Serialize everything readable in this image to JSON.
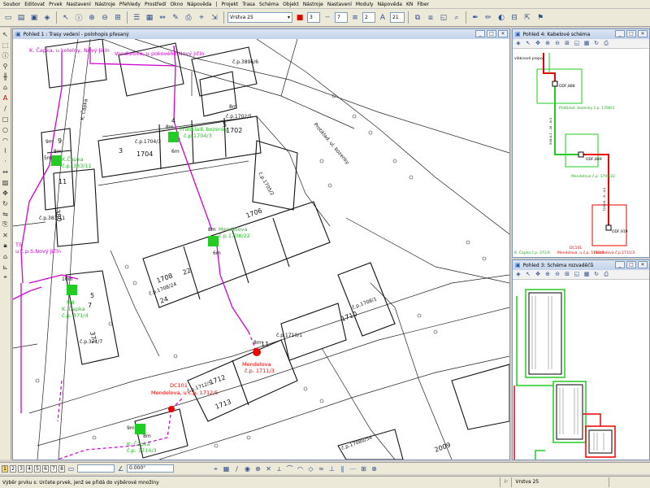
{
  "menu": [
    "Soubor",
    "Editovat",
    "Prvek",
    "Nastavení",
    "Nástroje",
    "Přehledy",
    "Prostředí",
    "Okno",
    "Nápověda",
    "|",
    "Projekt",
    "Trasa",
    "Schéma",
    "Objekt",
    "Nástroje",
    "Nastavení",
    "Moduly",
    "Nápověda",
    "KN",
    "Fiber"
  ],
  "toolbar": {
    "layer_combo": "Vrstva 25",
    "line_width": "3",
    "line_style": "7",
    "line_weight": "2",
    "zoom_value": "21"
  },
  "window_main": {
    "title": "Pohled 1 : Trasy vedení - polohopis přesaný",
    "labels_magenta": {
      "capka_kotelny": "K. Čapka, u kotelny, Nový Jičín",
      "vanduruva": "Vandurova, u pokovéhé Nový Jičín",
      "ts_nj": "TS",
      "ts_nj2": "u č.p.S.Nový Jičín",
      "dc101": "DC101",
      "dc101b": "Mendelova, u č.p. 1712/5"
    },
    "labels_green": {
      "ptkt_bozenky": "Protiklad. bozenky",
      "ptkt_bozenky2": "č.p.1704/3",
      "kcapka1": "K.Čapka",
      "kcapka1b": "č.p. 383/11",
      "mendelova1": "Mendelova",
      "mendelova1b": "č.p.1708/22",
      "m1": "M8",
      "m1b": "K. Čapka",
      "m1c": "č.p. 371/4",
      "kcapka2": "K. Čapka",
      "kcapka2b": "č.p. 1714/3"
    },
    "labels_red": {
      "mendelova_red": "Mendelova",
      "mendelova_red2": "č.p. 1711/3"
    },
    "map_texts": {
      "street1": "K. Čapka",
      "street2": "Protiklad. ul. bozenky",
      "street3": "Mendelova",
      "cp_17025": "č.p.1702/5",
      "cp_1702": "1702",
      "cp_17043": "č.p.1704/3",
      "cp_1704": "1704",
      "cp_17052": "č.p.1705/2",
      "cp_1706": "1706",
      "cp_1708": "1708",
      "cp_1708_24": "č.p.1708/24",
      "cp_22": "22",
      "cp_24": "24",
      "cp_3806": "č.p.3896/6",
      "cp_380": "380",
      "cp_3811": "č.p.383/11",
      "cp_371": "371",
      "cp_3717": "č.p.371/7",
      "cp_1710": "1710",
      "cp_17081": "č.p.1708/1",
      "cp_17101": "č.p.1710/1",
      "cp_11": "11",
      "cp_1712": "1712",
      "cp_17125": "č.p.1712/5",
      "cp_1713": "1713",
      "cp_2009": "2009",
      "cp_17135": "č.p.17080/54",
      "dist_8m_a": "8m",
      "dist_8m_b": "8m",
      "dist_6m_a": "6m",
      "dist_9m": "9m",
      "dist_5m": "5m",
      "dist_8m_c": "8m",
      "dist_6m_b": "6m",
      "dist_10m": "10m",
      "dist_8m_d": "8m",
      "dist_9m_b": "9m",
      "dist_8m_e": "8m",
      "dist_8m_f": "8m",
      "num_3": "3",
      "num_4": "4",
      "num_5": "5",
      "num_9": "9",
      "num_11": "11",
      "num_7": "7",
      "num_5b": "5"
    }
  },
  "window_schema": {
    "title": "Pohled 4: Kabelové schéma",
    "top_label": "vláknové propoj",
    "odf1": "ODF,888",
    "odf1_label": "Protiklad. bozenky č.p. 1704/3",
    "odf2": "ODF,889",
    "odf2_label": "Mendelova č.p. 1708/22",
    "odf3": "ODF,919",
    "odf3_label": "Mendelova č.p. 1711/3",
    "cable1": "5X6/4.1 - 26 - 8/1",
    "cable2": "72X6/4 - 8 - 4/1",
    "bottom1": "K. Čapka č.p. 371/4",
    "bottom2": "DC101",
    "bottom3": "Mendelova, u č.p. 1712/5",
    "bottom4": "Mendelova č.p.1711/3"
  },
  "window_connections": {
    "title": "Pohled 3: Schéma rozvaděčů"
  },
  "bottombar": {
    "pages": [
      "1",
      "2",
      "3",
      "4",
      "5",
      "6",
      "7",
      "8"
    ],
    "length_value": "",
    "angle_value": "0.000°"
  },
  "status": {
    "message": "Výběr prvku s: Určete prvek, jenž se přidá do výběrové množiny",
    "layer": "Vrstva 25"
  }
}
